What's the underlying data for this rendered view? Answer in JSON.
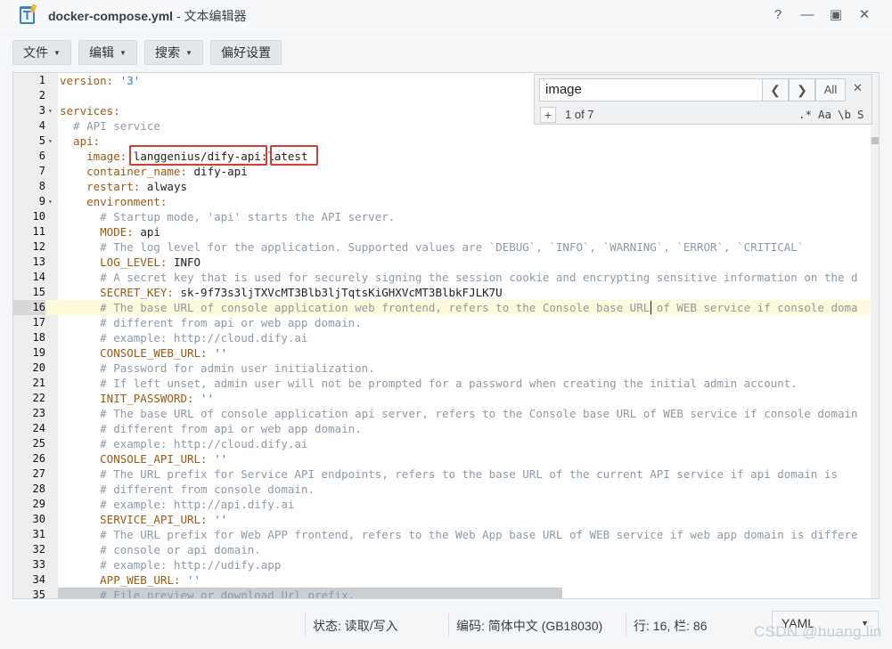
{
  "window": {
    "title_file": "docker-compose.yml",
    "title_app": " - 文本编辑器",
    "help": "?",
    "minimize": "—",
    "maximize": "▣",
    "close": "✕"
  },
  "toolbar": {
    "file": "文件",
    "edit": "编辑",
    "search": "搜索",
    "prefs": "偏好设置"
  },
  "search_panel": {
    "query": "image",
    "prev": "❮",
    "next": "❯",
    "all": "All",
    "close": "✕",
    "plus": "+",
    "count": "1 of 7",
    "regex": ".*",
    "case": "Aa",
    "word": "\\b",
    "selection": "S"
  },
  "lines": [
    "1",
    "2",
    "3",
    "4",
    "5",
    "6",
    "7",
    "8",
    "9",
    "10",
    "11",
    "12",
    "13",
    "14",
    "15",
    "16",
    "17",
    "18",
    "19",
    "20",
    "21",
    "22",
    "23",
    "24",
    "25",
    "26",
    "27",
    "28",
    "29",
    "30",
    "31",
    "32",
    "33",
    "34",
    "35"
  ],
  "code": {
    "l1_k": "version: ",
    "l1_v": "'3'",
    "l3_k": "services:",
    "l4_c": "  # API service",
    "l5_k": "  api:",
    "l6_k": "    image: ",
    "l6_v": "langgenius/dify-api",
    "l6_sep": ":",
    "l6_tag": "latest",
    "l7_k": "    container_name: ",
    "l7_v": "dify-api",
    "l8_k": "    restart: ",
    "l8_v": "always",
    "l9_k": "    environment:",
    "l10_c": "      # Startup mode, 'api' starts the API server.",
    "l11_k": "      MODE: ",
    "l11_v": "api",
    "l12_c": "      # The log level for the application. Supported values are `DEBUG`, `INFO`, `WARNING`, `ERROR`, `CRITICAL`",
    "l13_k": "      LOG_LEVEL: ",
    "l13_v": "INFO",
    "l14_c": "      # A secret key that is used for securely signing the session cookie and encrypting sensitive information on the d",
    "l15_k": "      SECRET_KEY: ",
    "l15_v": "sk-9f73s3ljTXVcMT3Blb3ljTqtsKiGHXVcMT3BlbkFJLK7U",
    "l16_c": "      # The base URL of console application web frontend, refers to the Console base URL of WEB service if console doma",
    "l17_c": "      # different from api or web app domain.",
    "l18_c": "      # example: http://cloud.dify.ai",
    "l19_k": "      CONSOLE_WEB_URL: ",
    "l19_v": "''",
    "l20_c": "      # Password for admin user initialization.",
    "l21_c": "      # If left unset, admin user will not be prompted for a password when creating the initial admin account.",
    "l22_k": "      INIT_PASSWORD: ",
    "l22_v": "''",
    "l23_c": "      # The base URL of console application api server, refers to the Console base URL of WEB service if console domain",
    "l24_c": "      # different from api or web app domain.",
    "l25_c": "      # example: http://cloud.dify.ai",
    "l26_k": "      CONSOLE_API_URL: ",
    "l26_v": "''",
    "l27_c": "      # The URL prefix for Service API endpoints, refers to the base URL of the current API service if api domain is",
    "l28_c": "      # different from console domain.",
    "l29_c": "      # example: http://api.dify.ai",
    "l30_k": "      SERVICE_API_URL: ",
    "l30_v": "''",
    "l31_c": "      # The URL prefix for Web APP frontend, refers to the Web App base URL of WEB service if web app domain is differe",
    "l32_c": "      # console or api domain.",
    "l33_c": "      # example: http://udify.app",
    "l34_k": "      APP_WEB_URL: ",
    "l34_v": "''",
    "l35_c": "      # File preview or download Url prefix."
  },
  "status": {
    "state": "状态:  读取/写入",
    "encoding": "编码:  简体中文 (GB18030)",
    "position": "行: 16, 栏: 86",
    "language": "YAML"
  },
  "watermark": "CSDN @huang.lin"
}
